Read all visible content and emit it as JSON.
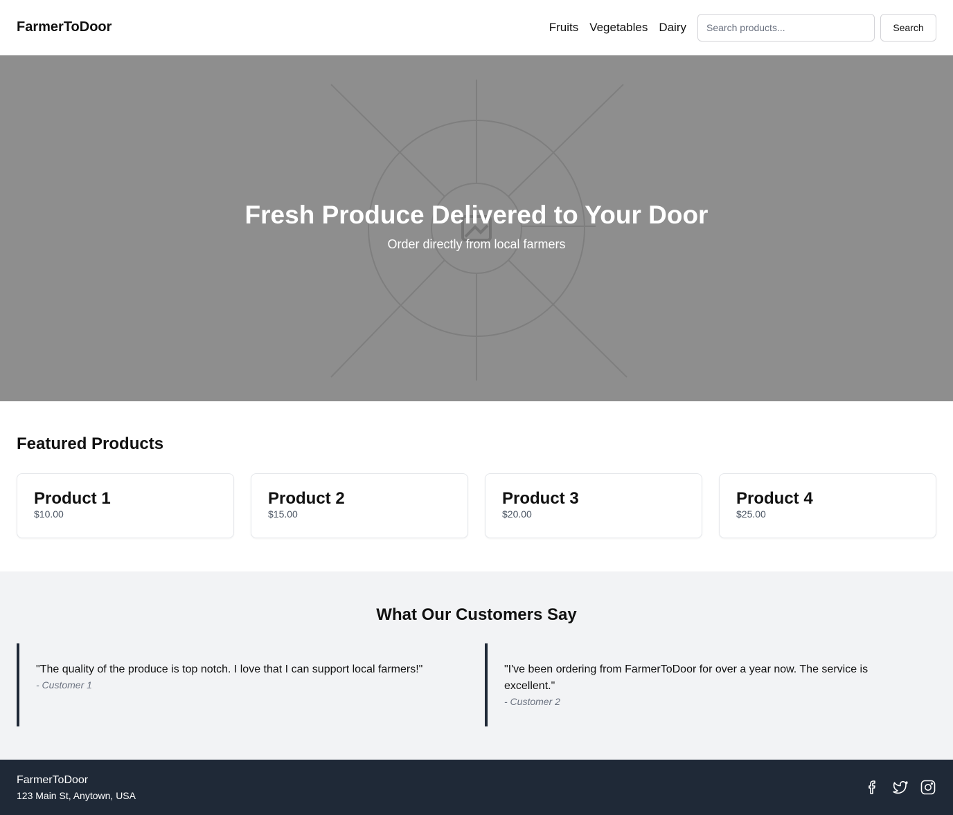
{
  "header": {
    "brand": "FarmerToDoor",
    "nav": [
      "Fruits",
      "Vegetables",
      "Dairy"
    ],
    "search_placeholder": "Search products...",
    "search_button": "Search"
  },
  "hero": {
    "title": "Fresh Produce Delivered to Your Door",
    "subtitle": "Order directly from local farmers",
    "image_icon": "image-placeholder-icon"
  },
  "featured": {
    "title": "Featured Products",
    "products": [
      {
        "name": "Product 1",
        "price": "$10.00"
      },
      {
        "name": "Product 2",
        "price": "$15.00"
      },
      {
        "name": "Product 3",
        "price": "$20.00"
      },
      {
        "name": "Product 4",
        "price": "$25.00"
      }
    ]
  },
  "testimonials": {
    "title": "What Our Customers Say",
    "items": [
      {
        "text": "\"The quality of the produce is top notch. I love that I can support local farmers!\"",
        "author": "- Customer 1"
      },
      {
        "text": "\"I've been ordering from FarmerToDoor for over a year now. The service is excellent.\"",
        "author": "- Customer 2"
      }
    ]
  },
  "footer": {
    "brand": "FarmerToDoor",
    "address": "123 Main St, Anytown, USA",
    "socials": [
      "facebook-icon",
      "twitter-icon",
      "instagram-icon"
    ]
  },
  "colors": {
    "hero_bg": "#8e8e8e",
    "testimonials_bg": "#f2f3f5",
    "footer_bg": "#1f2937",
    "quote_border": "#1f2937"
  }
}
